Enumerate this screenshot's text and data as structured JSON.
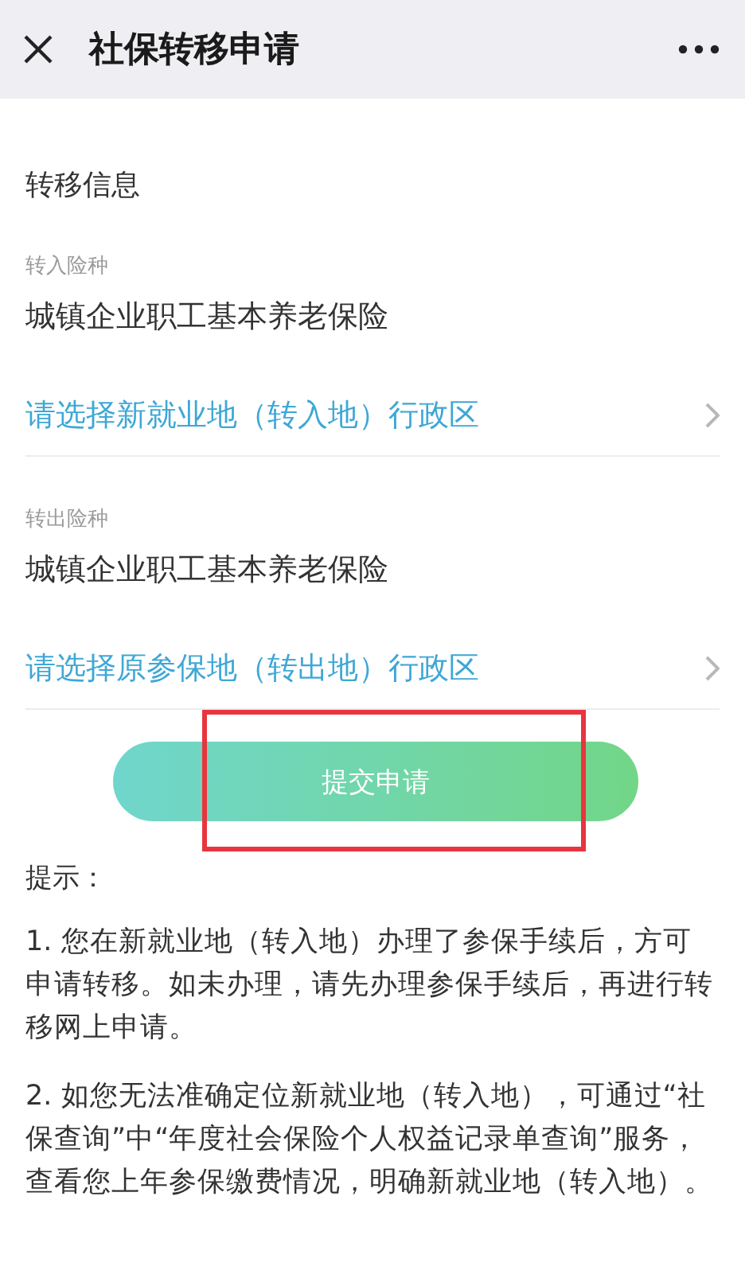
{
  "header": {
    "title": "社保转移申请"
  },
  "section_title": "转移信息",
  "fields": [
    {
      "label": "转入险种",
      "value": "城镇企业职工基本养老保险",
      "picker": "请选择新就业地（转入地）行政区"
    },
    {
      "label": "转出险种",
      "value": "城镇企业职工基本养老保险",
      "picker": "请选择原参保地（转出地）行政区"
    }
  ],
  "submit": {
    "label": "提交申请",
    "highlighted": true
  },
  "tips": {
    "title": "提示：",
    "items": [
      "1. 您在新就业地（转入地）办理了参保手续后，方可申请转移。如未办理，请先办理参保手续后，再进行转移网上申请。",
      "2. 如您无法准确定位新就业地（转入地），可通过“社保查询”中“年度社会保险个人权益记录单查询”服务，查看您上年参保缴费情况，明确新就业地（转入地）。"
    ]
  }
}
